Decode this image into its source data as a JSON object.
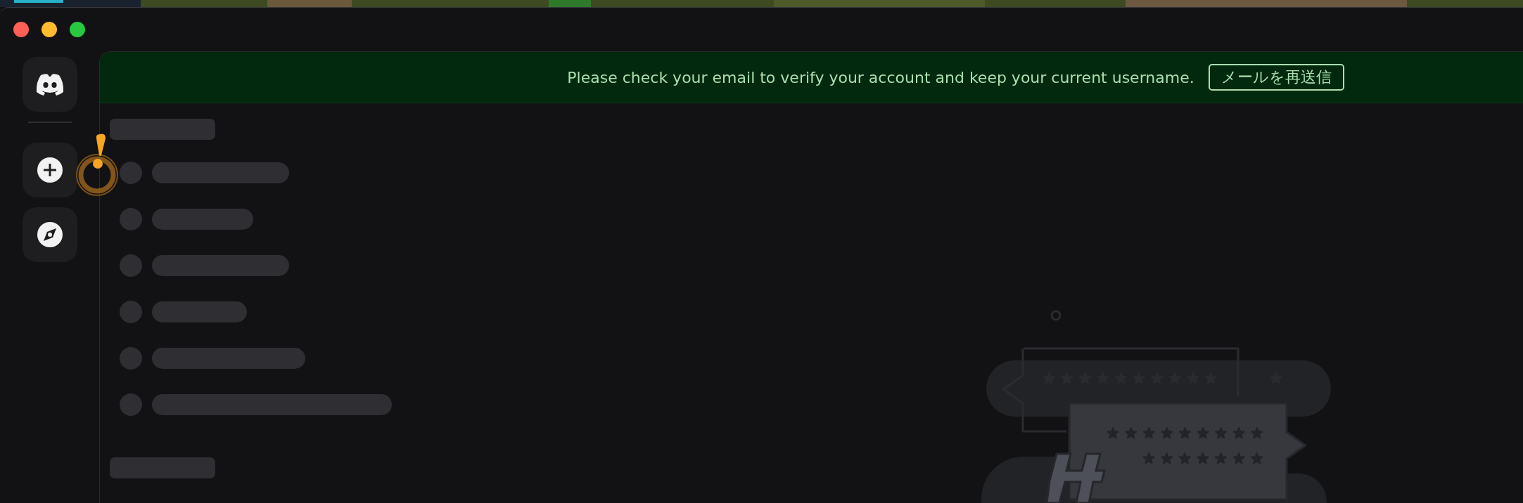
{
  "banner": {
    "message": "Please check your email to verify your account and keep your current username.",
    "button": "メールを再送信"
  }
}
